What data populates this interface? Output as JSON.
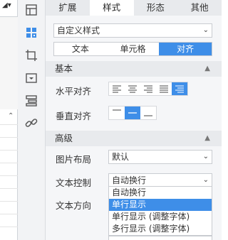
{
  "tabs": [
    {
      "label": "扩展"
    },
    {
      "label": "样式"
    },
    {
      "label": "形态"
    },
    {
      "label": "其他"
    }
  ],
  "style_select": {
    "value": "自定义样式"
  },
  "segment": {
    "items": [
      "文本",
      "单元格",
      "对齐"
    ],
    "active_index": 2
  },
  "sections": {
    "basic": {
      "title": "基本"
    },
    "advanced": {
      "title": "高级"
    }
  },
  "basic": {
    "horizontal_label": "水平对齐",
    "vertical_label": "垂直对齐"
  },
  "advanced": {
    "image_layout_label": "图片布局",
    "image_layout_value": "默认",
    "text_control_label": "文本控制",
    "text_control_value": "自动换行",
    "text_direction_label": "文本方向"
  },
  "text_control_options": [
    "自动换行",
    "单行显示",
    "单行显示 (调整字体)",
    "多行显示 (调整字体)"
  ],
  "text_control_highlighted": "单行显示",
  "colors": {
    "accent": "#3e8ee8",
    "panel": "#f5f6f8",
    "tab_bar": "#e8eaed"
  },
  "rail_icons": [
    "layout-icon",
    "cell-style-icon",
    "crop-icon",
    "widget-icon",
    "stack-icon",
    "link-icon"
  ],
  "left_strip": {
    "icons": [
      "corner-arrow-icon",
      "chevron-up-icon"
    ]
  }
}
